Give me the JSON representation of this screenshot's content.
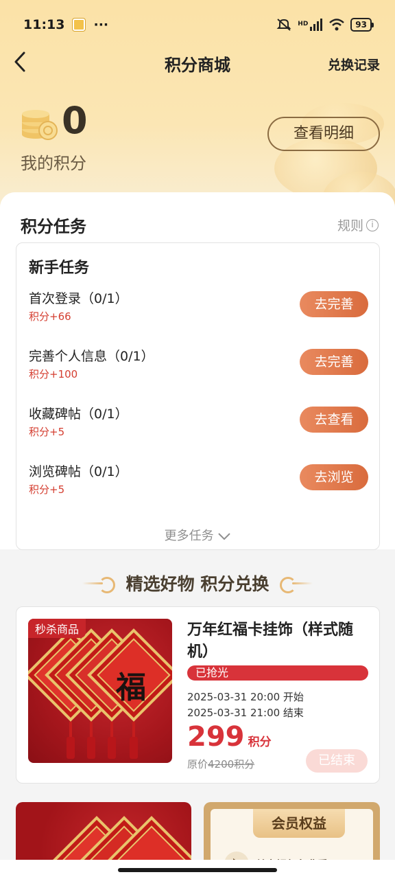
{
  "status_bar": {
    "time": "11:13",
    "dots": "···",
    "network": "HD",
    "battery": "93"
  },
  "nav": {
    "title": "积分商城",
    "right_link": "兑换记录"
  },
  "points": {
    "value": "0",
    "label": "我的积分",
    "detail_button": "查看明细"
  },
  "tasks_section": {
    "title": "积分任务",
    "rules_label": "规则",
    "card_title": "新手任务",
    "tasks": [
      {
        "name": "首次登录（0/1）",
        "reward": "积分+66",
        "button": "去完善"
      },
      {
        "name": "完善个人信息（0/1）",
        "reward": "积分+100",
        "button": "去完善"
      },
      {
        "name": "收藏碑帖（0/1）",
        "reward": "积分+5",
        "button": "去查看"
      },
      {
        "name": "浏览碑帖（0/1）",
        "reward": "积分+5",
        "button": "去浏览"
      }
    ],
    "more_label": "更多任务"
  },
  "goods_section": {
    "title": "精选好物 积分兑换",
    "product": {
      "badge": "秒杀商品",
      "fu_char": "福",
      "name": "万年红福卡挂饰（样式随机）",
      "status": "已抢光",
      "start_time": "2025-03-31 20:00 开始",
      "end_time": "2025-03-31 21:00 结束",
      "price": "299",
      "price_unit": "积分",
      "original_label": "原价",
      "original_price": "4200积分",
      "action_button": "已结束"
    },
    "member_card": {
      "title": "会员权益",
      "line": "单字视频免费看"
    }
  }
}
